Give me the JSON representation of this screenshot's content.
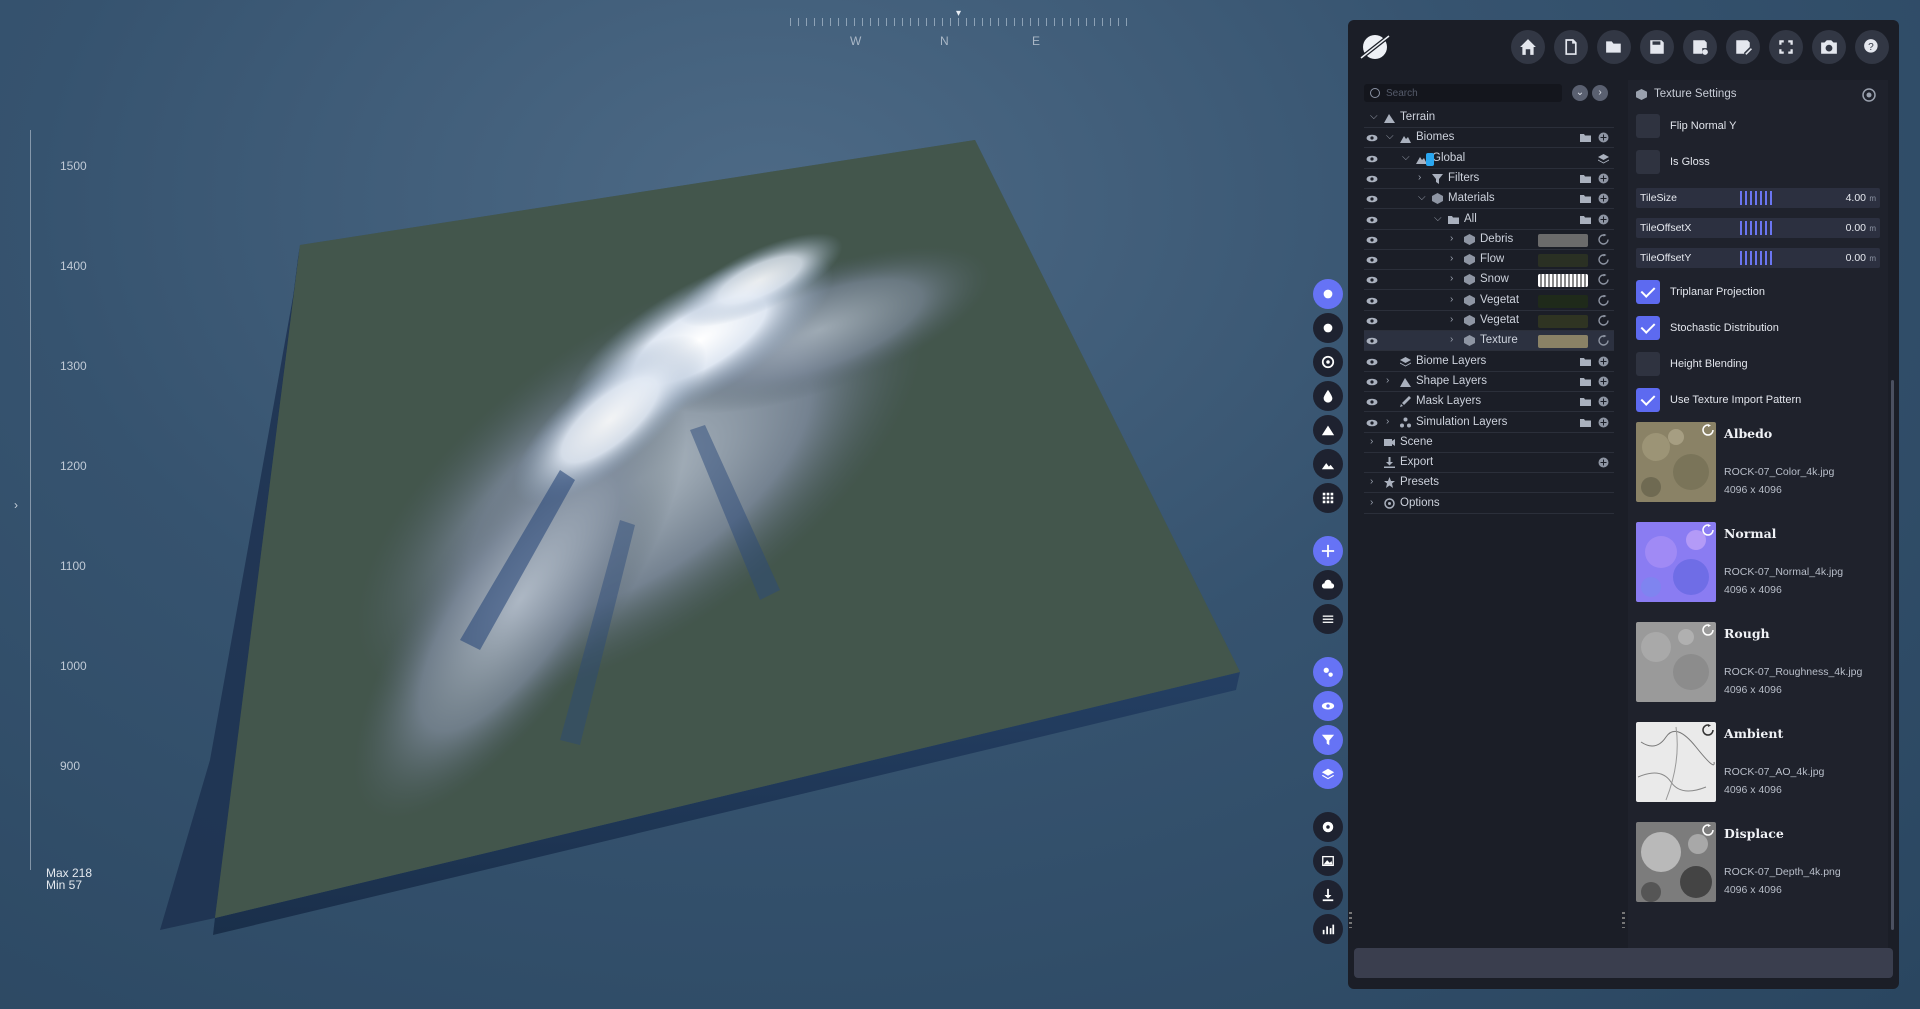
{
  "compass": {
    "w": "W",
    "n": "N",
    "e": "E"
  },
  "scale": {
    "labels": [
      "1500",
      "1400",
      "1300",
      "1200",
      "1100",
      "1000",
      "900"
    ],
    "max": "Max 218",
    "min": "Min 57"
  },
  "toolbar": {
    "buttons": [
      "home-icon",
      "new-file-icon",
      "open-folder-icon",
      "save-icon",
      "save-settings-icon",
      "save-as-icon",
      "refresh-icon",
      "camera-icon",
      "help-icon"
    ]
  },
  "tree": {
    "search_placeholder": "Search",
    "rows": {
      "terrain": "Terrain",
      "biomes": "Biomes",
      "global": "Global",
      "filters": "Filters",
      "materials": "Materials",
      "all": "All",
      "debris": "Debris",
      "flow": "Flow",
      "snow": "Snow",
      "veg1": "Vegetat",
      "veg2": "Vegetat",
      "texture": "Texture",
      "biome_layers": "Biome Layers",
      "shape_layers": "Shape Layers",
      "mask_layers": "Mask Layers",
      "simulation_layers": "Simulation Layers",
      "scene": "Scene",
      "export": "Export",
      "presets": "Presets",
      "options": "Options"
    }
  },
  "settings": {
    "title": "Texture Settings",
    "flip_normal_y": {
      "label": "Flip Normal Y",
      "checked": false
    },
    "is_gloss": {
      "label": "Is Gloss",
      "checked": false
    },
    "tile_size": {
      "label": "TileSize",
      "value": "4.00",
      "unit": "m"
    },
    "tile_offset_x": {
      "label": "TileOffsetX",
      "value": "0.00",
      "unit": "m"
    },
    "tile_offset_y": {
      "label": "TileOffsetY",
      "value": "0.00",
      "unit": "m"
    },
    "triplanar": {
      "label": "Triplanar Projection",
      "checked": true
    },
    "stochastic": {
      "label": "Stochastic Distribution",
      "checked": true
    },
    "height_blending": {
      "label": "Height Blending",
      "checked": false
    },
    "use_import_pattern": {
      "label": "Use Texture Import Pattern",
      "checked": true
    },
    "textures": [
      {
        "name": "Albedo",
        "file": "ROCK-07_Color_4k.jpg",
        "size": "4096 x 4096"
      },
      {
        "name": "Normal",
        "file": "ROCK-07_Normal_4k.jpg",
        "size": "4096 x 4096"
      },
      {
        "name": "Rough",
        "file": "ROCK-07_Roughness_4k.jpg",
        "size": "4096 x 4096"
      },
      {
        "name": "Ambient",
        "file": "ROCK-07_AO_4k.jpg",
        "size": "4096 x 4096"
      },
      {
        "name": "Displace",
        "file": "ROCK-07_Depth_4k.png",
        "size": "4096 x 4096"
      }
    ]
  },
  "colors": {
    "accent": "#5d6af0",
    "panel": "#1b1e27",
    "sky": "#3a5875"
  }
}
